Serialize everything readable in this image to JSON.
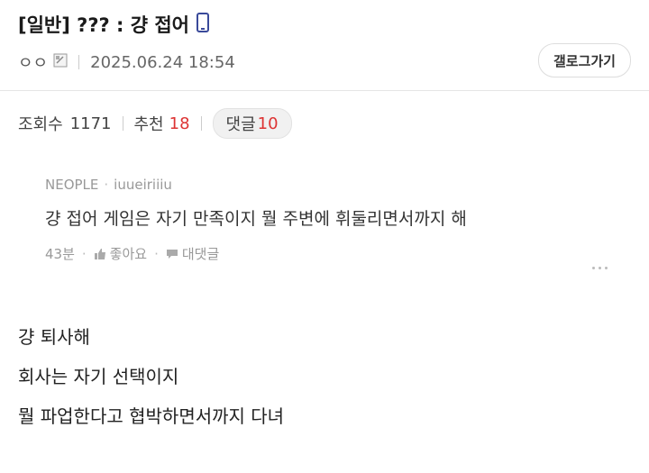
{
  "post": {
    "title": "[일반] ??? : 걍 접어",
    "author": "ㅇㅇ",
    "date": "2025.06.24 18:54",
    "gallery_button": "갤로그가기"
  },
  "stats": {
    "views_label": "조회수",
    "views_value": "1171",
    "recommend_label": "추천",
    "recommend_value": "18",
    "comments_label": "댓글",
    "comments_value": "10"
  },
  "quoted_comment": {
    "source": "NEOPLE",
    "user": "iuueiriiiu",
    "text": "걍 접어 게임은 자기 만족이지 뭘 주변에 휘둘리면서까지 해",
    "time": "43분",
    "like_label": "좋아요",
    "reply_label": "대댓글"
  },
  "body": {
    "lines": [
      "걍 퇴사해",
      "회사는 자기 선택이지",
      "뭘 파업한다고 협박하면서까지 다녀"
    ]
  },
  "colors": {
    "accent_red": "#d33",
    "muted": "#999",
    "phone_icon": "#3a4a9a"
  }
}
